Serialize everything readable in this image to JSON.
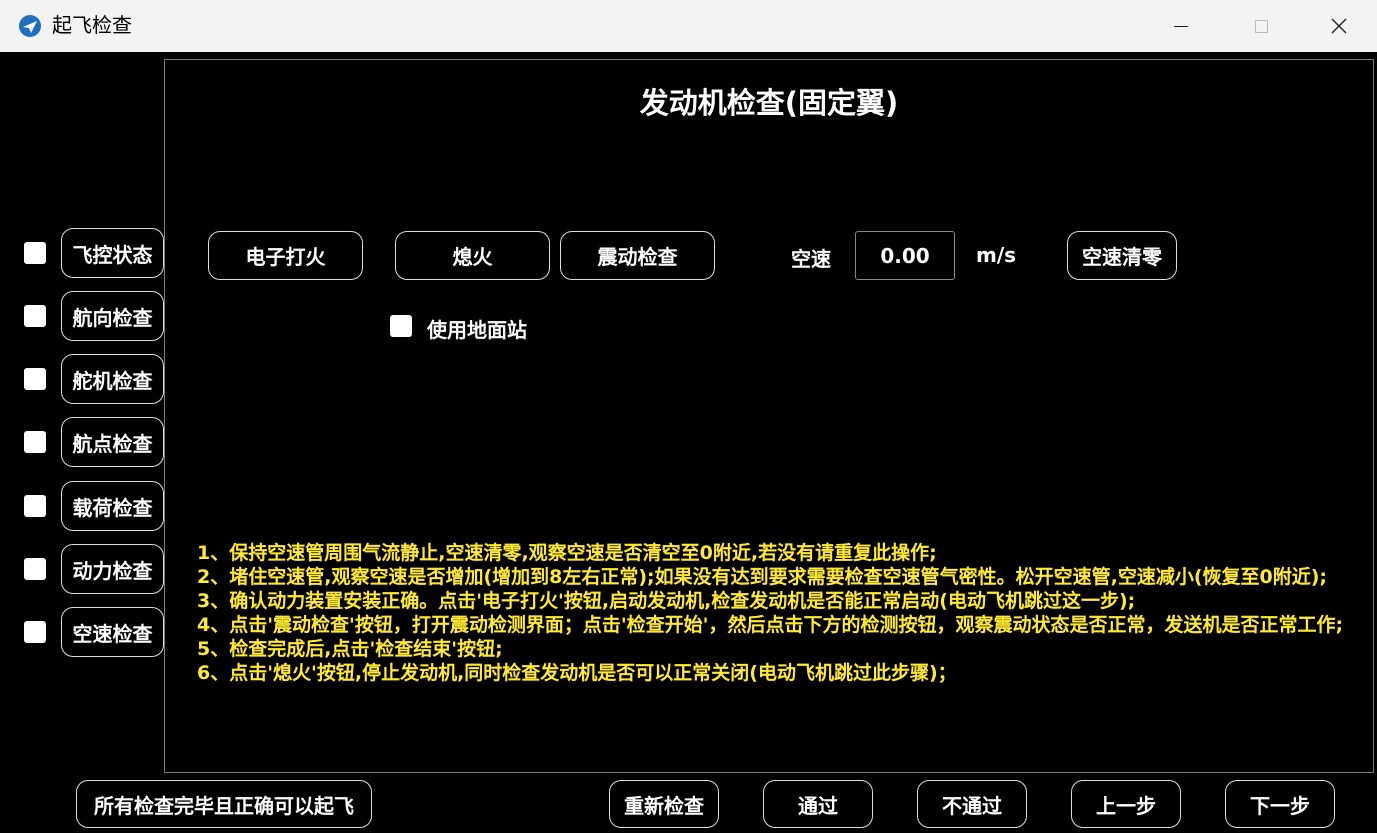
{
  "window": {
    "title": "起飞检查"
  },
  "panel": {
    "heading": "发动机检查(固定翼)",
    "buttons": {
      "ignite": "电子打火",
      "shutdown": "熄火",
      "vibration": "震动检查",
      "zero_airspeed": "空速清零"
    },
    "airspeed": {
      "label": "空速",
      "value": "0.00",
      "unit": "m/s"
    },
    "ground_station": {
      "label": "使用地面站",
      "checked": false
    },
    "instructions": [
      "1、保持空速管周围气流静止,空速清零,观察空速是否清空至0附近,若没有请重复此操作;",
      "2、堵住空速管,观察空速是否增加(增加到8左右正常);如果没有达到要求需要检查空速管气密性。松开空速管,空速减小(恢复至0附近);",
      "3、确认动力装置安装正确。点击'电子打火'按钮,启动发动机,检查发动机是否能正常启动(电动飞机跳过这一步);",
      "4、点击'震动检查'按钮，打开震动检测界面；点击'检查开始'，然后点击下方的检测按钮，观察震动状态是否正常，发送机是否正常工作;",
      "5、检查完成后,点击'检查结束'按钮;",
      "6、点击'熄火'按钮,停止发动机,同时检查发动机是否可以正常关闭(电动飞机跳过此步骤)；"
    ]
  },
  "sidebar": {
    "items": [
      {
        "label": "飞控状态",
        "checked": false
      },
      {
        "label": "航向检查",
        "checked": false
      },
      {
        "label": "舵机检查",
        "checked": false
      },
      {
        "label": "航点检查",
        "checked": false
      },
      {
        "label": "载荷检查",
        "checked": false
      },
      {
        "label": "动力检查",
        "checked": false
      },
      {
        "label": "空速检查",
        "checked": false
      }
    ]
  },
  "footer": {
    "ready_label": "所有检查完毕且正确可以起飞",
    "recheck": "重新检查",
    "pass": "通过",
    "fail": "不通过",
    "prev": "上一步",
    "next": "下一步"
  }
}
